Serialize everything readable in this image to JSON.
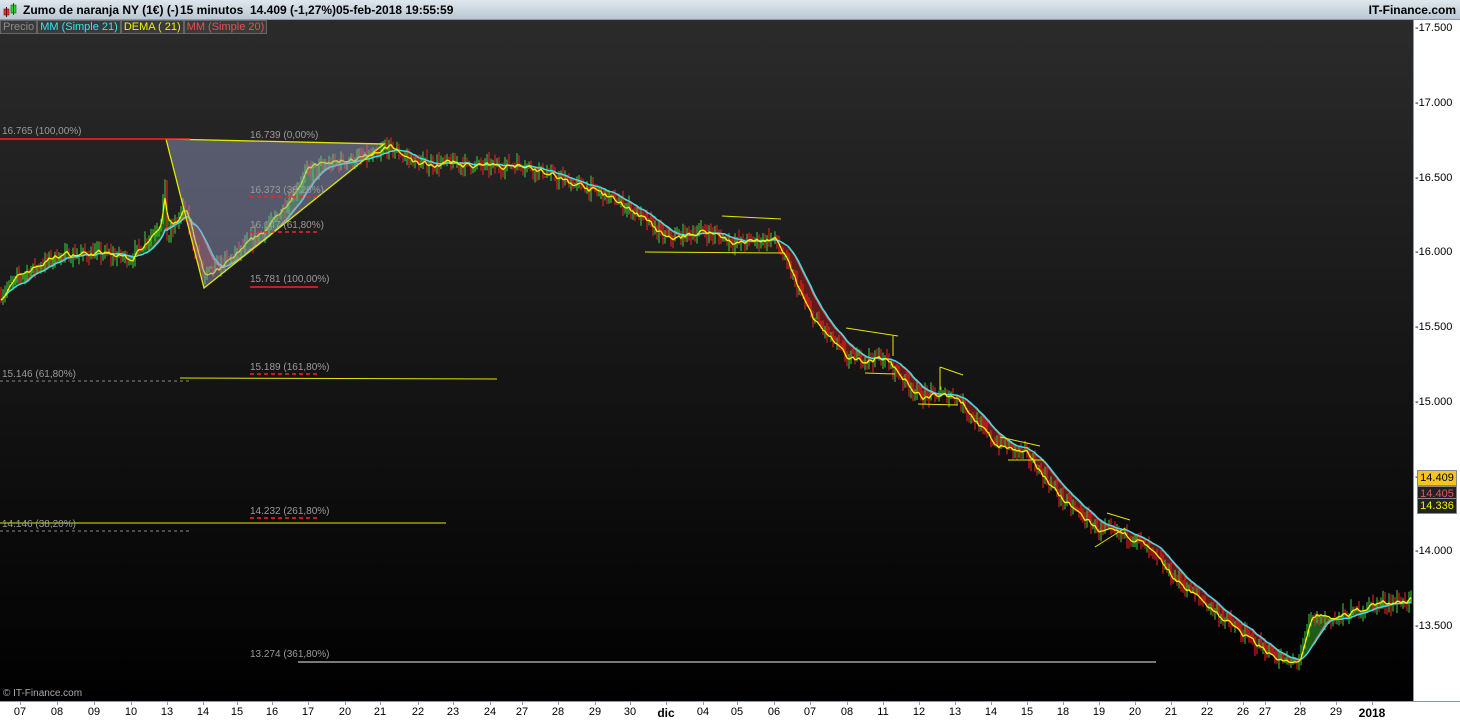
{
  "header": {
    "instrument": "Zumo de naranja NY (1€) (-)",
    "timeframe": "15 minutos",
    "last": "14.409 (-1,27%)",
    "datetime": "05-feb-2018 19:55:59",
    "brand": "IT-Finance.com"
  },
  "legend": [
    {
      "label": "Precio",
      "color": "#8c8c8c"
    },
    {
      "label": "MM (Simple 21)",
      "color": "#33e6f0"
    },
    {
      "label": "DEMA ( 21)",
      "color": "#f2f200"
    },
    {
      "label": "MM (Simple 20)",
      "color": "#e85050"
    }
  ],
  "copyright": "© IT-Finance.com",
  "chart_data": {
    "type": "candlestick",
    "x_ticks": [
      "07",
      "08",
      "09",
      "10",
      "13",
      "14",
      "15",
      "16",
      "17",
      "20",
      "21",
      "22",
      "23",
      "24",
      "27",
      "28",
      "29",
      "30",
      "dic",
      "04",
      "05",
      "06",
      "07",
      "08",
      "11",
      "12",
      "13",
      "14",
      "15",
      "18",
      "19",
      "20",
      "21",
      "22",
      "26",
      "27",
      "28",
      "29",
      "2018"
    ],
    "bold_ticks": [
      "dic",
      "2018"
    ],
    "close_approx": [
      15.85,
      15.98,
      16.0,
      15.97,
      16.1,
      15.85,
      16.0,
      16.2,
      16.55,
      16.62,
      16.65,
      16.6,
      16.6,
      16.58,
      16.6,
      16.5,
      16.42,
      16.3,
      16.1,
      16.15,
      16.07,
      16.1,
      15.6,
      15.3,
      15.3,
      15.05,
      15.05,
      14.75,
      14.65,
      14.35,
      14.15,
      14.1,
      13.85,
      13.65,
      13.45,
      13.35,
      13.3,
      13.55,
      13.65
    ],
    "y_ticks": [
      "17.500",
      "17.000",
      "16.500",
      "16.000",
      "15.500",
      "15.000",
      "14.500",
      "14.000",
      "13.500"
    ],
    "ylim": [
      13.2,
      17.6
    ],
    "last_values": [
      {
        "value": "14.409",
        "bg": "#f5c518",
        "fg": "#000000"
      },
      {
        "value": "14.405",
        "bg": "#222222",
        "fg": "#e05a5a"
      },
      {
        "value": "14.336",
        "bg": "#222222",
        "fg": "#f2f200"
      }
    ],
    "up_color": "#3cd23c",
    "down_color": "#ff1e1e",
    "fibonacci": [
      {
        "label": "16.765 (100,00%)",
        "price": 16.765
      },
      {
        "label": "16.739 (0,00%)",
        "price": 16.739
      },
      {
        "label": "16.373 (38,20%)",
        "price": 16.373
      },
      {
        "label": "16.147 (61,80%)",
        "price": 16.147
      },
      {
        "label": "15.781 (100,00%)",
        "price": 15.781
      },
      {
        "label": "15.146 (61,80%)",
        "price": 15.146
      },
      {
        "label": "15.189 (161,80%)",
        "price": 15.189
      },
      {
        "label": "14.146 (38,20%)",
        "price": 14.146
      },
      {
        "label": "14.232 (261,80%)",
        "price": 14.232
      },
      {
        "label": "13.274 (361,80%)",
        "price": 13.274
      }
    ]
  }
}
